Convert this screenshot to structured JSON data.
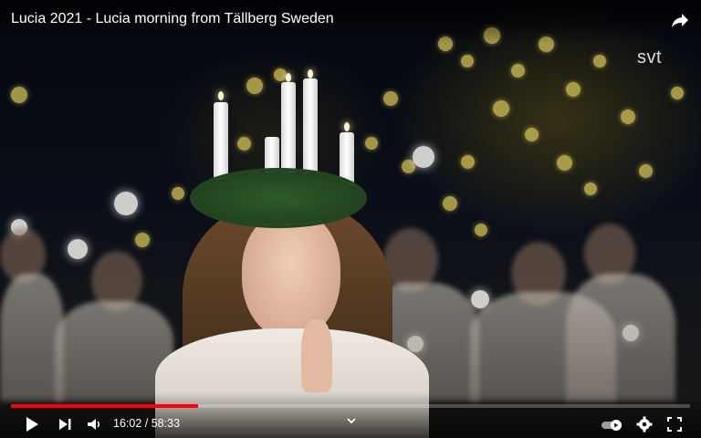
{
  "header": {
    "title": "Lucia 2021 - Lucia morning from Tällberg Sweden",
    "share_icon": "share-arrow-icon"
  },
  "watermark": {
    "text": "svt"
  },
  "player": {
    "progress": {
      "played_fraction": 0.275,
      "color": "#ff0000"
    },
    "time": {
      "current": "16:02",
      "separator": "/",
      "duration": "58:33"
    },
    "icons": {
      "play": "play-icon",
      "next": "next-icon",
      "volume": "volume-icon",
      "chapters": "chevron-down-icon",
      "autoplay": "autoplay-toggle-icon",
      "settings": "gear-icon",
      "fullscreen": "fullscreen-icon"
    }
  }
}
